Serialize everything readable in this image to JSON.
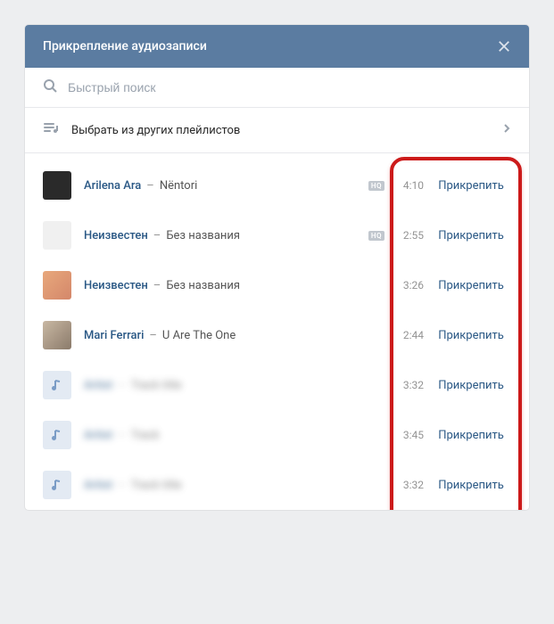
{
  "header": {
    "title": "Прикрепление аудиозаписи"
  },
  "search": {
    "placeholder": "Быстрый поиск"
  },
  "playlist_selector": {
    "label": "Выбрать из других плейлистов"
  },
  "attach_label": "Прикрепить",
  "tracks": [
    {
      "artist": "Arilena Ara",
      "title": "Nëntori",
      "duration": "4:10",
      "hq": true,
      "thumb": "dark",
      "blurred": false
    },
    {
      "artist": "Неизвестен",
      "title": "Без названия",
      "duration": "2:55",
      "hq": true,
      "thumb": "light",
      "blurred": false
    },
    {
      "artist": "Неизвестен",
      "title": "Без названия",
      "duration": "3:26",
      "hq": false,
      "thumb": "orange",
      "blurred": false
    },
    {
      "artist": "Mari Ferrari",
      "title": "U Are The One",
      "duration": "2:44",
      "hq": false,
      "thumb": "mixed",
      "blurred": false
    },
    {
      "artist": "Artist",
      "title": "Track title",
      "duration": "3:32",
      "hq": false,
      "thumb": "note",
      "blurred": true
    },
    {
      "artist": "Artist",
      "title": "Track",
      "duration": "3:45",
      "hq": false,
      "thumb": "note",
      "blurred": true
    },
    {
      "artist": "Artist",
      "title": "Track title",
      "duration": "3:32",
      "hq": false,
      "thumb": "note",
      "blurred": true
    }
  ]
}
